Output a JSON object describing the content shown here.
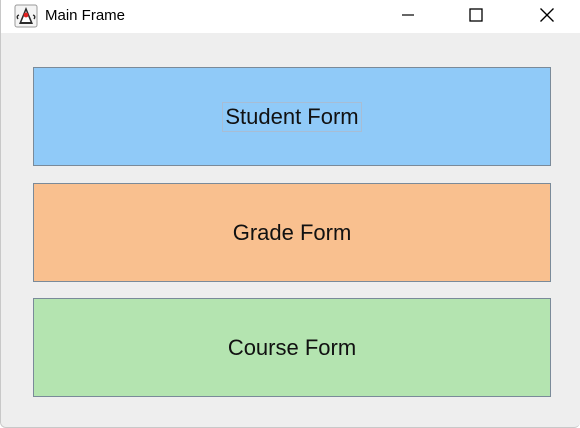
{
  "window": {
    "title": "Main Frame",
    "app_icon": "java-duke-icon",
    "controls": {
      "minimize": "minimize-icon",
      "maximize": "maximize-icon",
      "close": "close-icon"
    }
  },
  "buttons": [
    {
      "label": "Student Form",
      "color": "#90caf8",
      "focused": true
    },
    {
      "label": "Grade Form",
      "color": "#f9c08f",
      "focused": false
    },
    {
      "label": "Course Form",
      "color": "#b4e4b0",
      "focused": false
    }
  ]
}
